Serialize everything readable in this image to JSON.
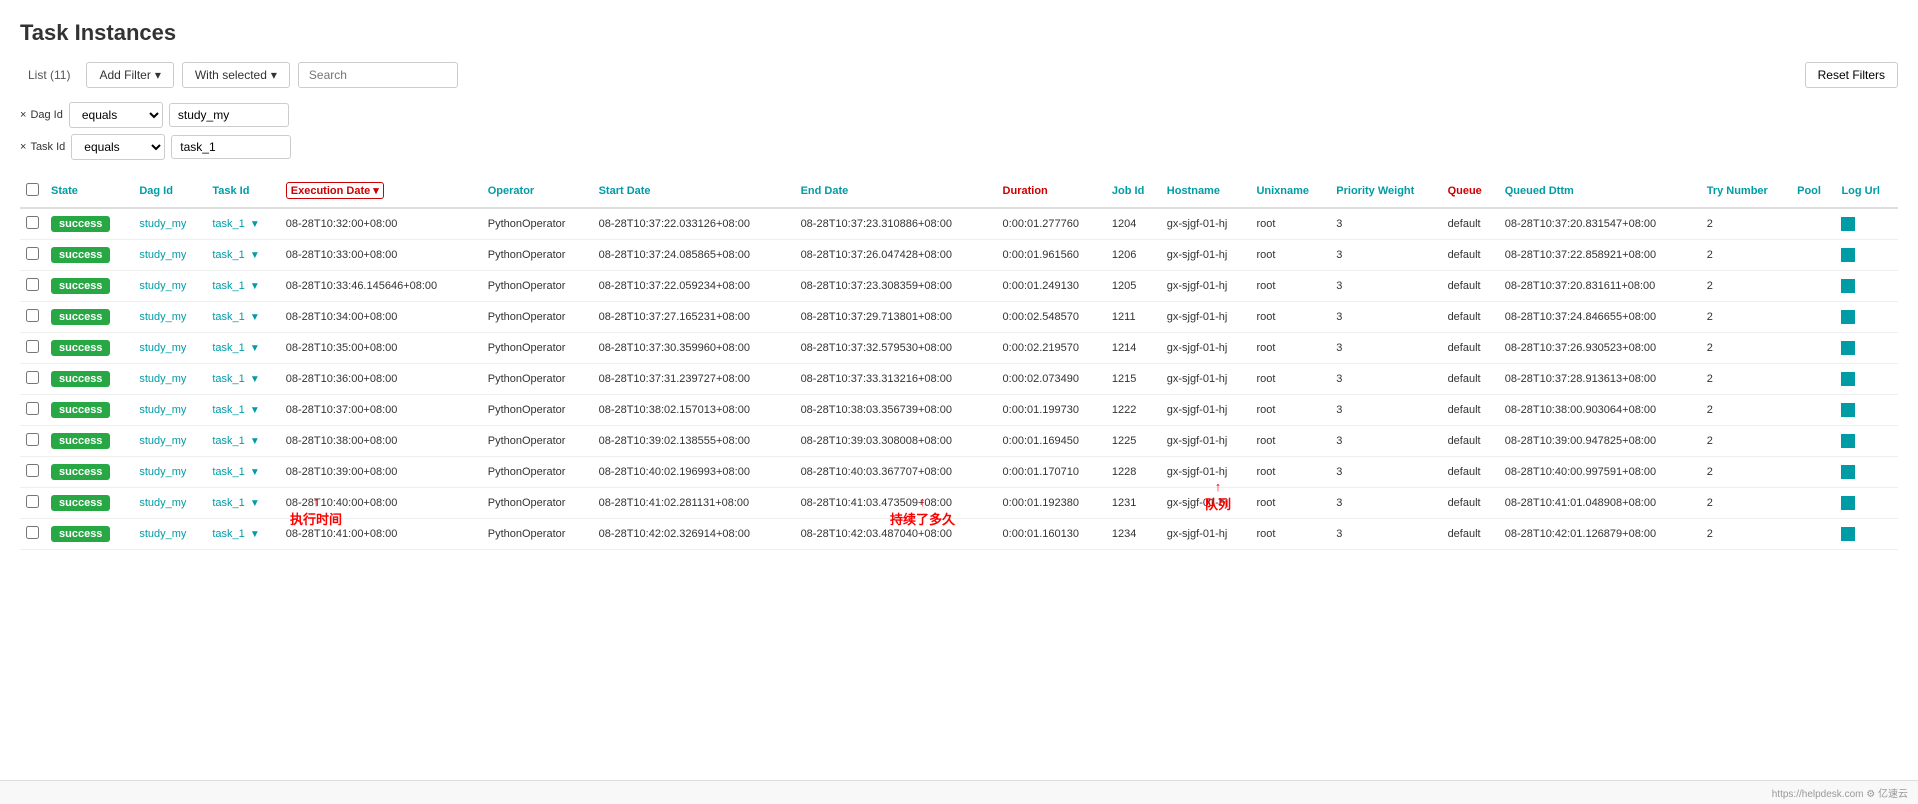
{
  "page": {
    "title": "Task Instances"
  },
  "toolbar": {
    "list_label": "List (11)",
    "add_filter_label": "Add Filter",
    "with_selected_label": "With selected",
    "search_placeholder": "Search",
    "reset_filters_label": "Reset Filters"
  },
  "filters": [
    {
      "id": "dag_id",
      "label": "Dag Id",
      "operator": "equals",
      "value": "study_my"
    },
    {
      "id": "task_id",
      "label": "Task Id",
      "operator": "equals",
      "value": "task_1"
    }
  ],
  "annotations": {
    "execution_date": "执行时间",
    "duration": "持续了多久",
    "queue": "队列"
  },
  "table": {
    "columns": [
      {
        "key": "state",
        "label": "State",
        "sortable": false
      },
      {
        "key": "dag_id",
        "label": "Dag Id",
        "sortable": false
      },
      {
        "key": "task_id",
        "label": "Task Id",
        "sortable": false
      },
      {
        "key": "execution_date",
        "label": "Execution Date",
        "sortable": true,
        "active": true,
        "highlighted": true
      },
      {
        "key": "operator",
        "label": "Operator",
        "sortable": false
      },
      {
        "key": "start_date",
        "label": "Start Date",
        "sortable": false
      },
      {
        "key": "end_date",
        "label": "End Date",
        "sortable": false
      },
      {
        "key": "duration",
        "label": "Duration",
        "sortable": false,
        "highlighted": true
      },
      {
        "key": "job_id",
        "label": "Job Id",
        "sortable": false
      },
      {
        "key": "hostname",
        "label": "Hostname",
        "sortable": false
      },
      {
        "key": "unixname",
        "label": "Unixname",
        "sortable": false
      },
      {
        "key": "priority_weight",
        "label": "Priority Weight",
        "sortable": false
      },
      {
        "key": "queue",
        "label": "Queue",
        "sortable": false,
        "highlighted": true
      },
      {
        "key": "queued_dttm",
        "label": "Queued Dttm",
        "sortable": false
      },
      {
        "key": "try_number",
        "label": "Try Number",
        "sortable": false
      },
      {
        "key": "pool",
        "label": "Pool",
        "sortable": false
      },
      {
        "key": "log_url",
        "label": "Log Url",
        "sortable": false
      }
    ],
    "rows": [
      {
        "state": "success",
        "dag_id": "study_my",
        "task_id": "task_1",
        "execution_date": "08-28T10:32:00+08:00",
        "operator": "PythonOperator",
        "start_date": "08-28T10:37:22.033126+08:00",
        "end_date": "08-28T10:37:23.310886+08:00",
        "duration": "0:00:01.277760",
        "job_id": "1204",
        "hostname": "gx-sjgf-01-hj",
        "unixname": "root",
        "priority_weight": "3",
        "queue": "default",
        "queued_dttm": "08-28T10:37:20.831547+08:00",
        "try_number": "2",
        "pool": "",
        "log_url": "box"
      },
      {
        "state": "success",
        "dag_id": "study_my",
        "task_id": "task_1",
        "execution_date": "08-28T10:33:00+08:00",
        "operator": "PythonOperator",
        "start_date": "08-28T10:37:24.085865+08:00",
        "end_date": "08-28T10:37:26.047428+08:00",
        "duration": "0:00:01.961560",
        "job_id": "1206",
        "hostname": "gx-sjgf-01-hj",
        "unixname": "root",
        "priority_weight": "3",
        "queue": "default",
        "queued_dttm": "08-28T10:37:22.858921+08:00",
        "try_number": "2",
        "pool": "",
        "log_url": "box"
      },
      {
        "state": "success",
        "dag_id": "study_my",
        "task_id": "task_1",
        "execution_date": "08-28T10:33:46.145646+08:00",
        "operator": "PythonOperator",
        "start_date": "08-28T10:37:22.059234+08:00",
        "end_date": "08-28T10:37:23.308359+08:00",
        "duration": "0:00:01.249130",
        "job_id": "1205",
        "hostname": "gx-sjgf-01-hj",
        "unixname": "root",
        "priority_weight": "3",
        "queue": "default",
        "queued_dttm": "08-28T10:37:20.831611+08:00",
        "try_number": "2",
        "pool": "",
        "log_url": "box"
      },
      {
        "state": "success",
        "dag_id": "study_my",
        "task_id": "task_1",
        "execution_date": "08-28T10:34:00+08:00",
        "operator": "PythonOperator",
        "start_date": "08-28T10:37:27.165231+08:00",
        "end_date": "08-28T10:37:29.713801+08:00",
        "duration": "0:00:02.548570",
        "job_id": "1211",
        "hostname": "gx-sjgf-01-hj",
        "unixname": "root",
        "priority_weight": "3",
        "queue": "default",
        "queued_dttm": "08-28T10:37:24.846655+08:00",
        "try_number": "2",
        "pool": "",
        "log_url": "box"
      },
      {
        "state": "success",
        "dag_id": "study_my",
        "task_id": "task_1",
        "execution_date": "08-28T10:35:00+08:00",
        "operator": "PythonOperator",
        "start_date": "08-28T10:37:30.359960+08:00",
        "end_date": "08-28T10:37:32.579530+08:00",
        "duration": "0:00:02.219570",
        "job_id": "1214",
        "hostname": "gx-sjgf-01-hj",
        "unixname": "root",
        "priority_weight": "3",
        "queue": "default",
        "queued_dttm": "08-28T10:37:26.930523+08:00",
        "try_number": "2",
        "pool": "",
        "log_url": "box"
      },
      {
        "state": "success",
        "dag_id": "study_my",
        "task_id": "task_1",
        "execution_date": "08-28T10:36:00+08:00",
        "operator": "PythonOperator",
        "start_date": "08-28T10:37:31.239727+08:00",
        "end_date": "08-28T10:37:33.313216+08:00",
        "duration": "0:00:02.073490",
        "job_id": "1215",
        "hostname": "gx-sjgf-01-hj",
        "unixname": "root",
        "priority_weight": "3",
        "queue": "default",
        "queued_dttm": "08-28T10:37:28.913613+08:00",
        "try_number": "2",
        "pool": "",
        "log_url": "box"
      },
      {
        "state": "success",
        "dag_id": "study_my",
        "task_id": "task_1",
        "execution_date": "08-28T10:37:00+08:00",
        "operator": "PythonOperator",
        "start_date": "08-28T10:38:02.157013+08:00",
        "end_date": "08-28T10:38:03.356739+08:00",
        "duration": "0:00:01.199730",
        "job_id": "1222",
        "hostname": "gx-sjgf-01-hj",
        "unixname": "root",
        "priority_weight": "3",
        "queue": "default",
        "queued_dttm": "08-28T10:38:00.903064+08:00",
        "try_number": "2",
        "pool": "",
        "log_url": "box"
      },
      {
        "state": "success",
        "dag_id": "study_my",
        "task_id": "task_1",
        "execution_date": "08-28T10:38:00+08:00",
        "operator": "PythonOperator",
        "start_date": "08-28T10:39:02.138555+08:00",
        "end_date": "08-28T10:39:03.308008+08:00",
        "duration": "0:00:01.169450",
        "job_id": "1225",
        "hostname": "gx-sjgf-01-hj",
        "unixname": "root",
        "priority_weight": "3",
        "queue": "default",
        "queued_dttm": "08-28T10:39:00.947825+08:00",
        "try_number": "2",
        "pool": "",
        "log_url": "box"
      },
      {
        "state": "success",
        "dag_id": "study_my",
        "task_id": "task_1",
        "execution_date": "08-28T10:39:00+08:00",
        "operator": "PythonOperator",
        "start_date": "08-28T10:40:02.196993+08:00",
        "end_date": "08-28T10:40:03.367707+08:00",
        "duration": "0:00:01.170710",
        "job_id": "1228",
        "hostname": "gx-sjgf-01-hj",
        "unixname": "root",
        "priority_weight": "3",
        "queue": "default",
        "queued_dttm": "08-28T10:40:00.997591+08:00",
        "try_number": "2",
        "pool": "",
        "log_url": "box"
      },
      {
        "state": "success",
        "dag_id": "study_my",
        "task_id": "task_1",
        "execution_date": "08-28T10:40:00+08:00",
        "operator": "PythonOperator",
        "start_date": "08-28T10:41:02.281131+08:00",
        "end_date": "08-28T10:41:03.473509+08:00",
        "duration": "0:00:01.192380",
        "job_id": "1231",
        "hostname": "gx-sjgf-01-hj",
        "unixname": "root",
        "priority_weight": "3",
        "queue": "default",
        "queued_dttm": "08-28T10:41:01.048908+08:00",
        "try_number": "2",
        "pool": "",
        "log_url": "box"
      },
      {
        "state": "success",
        "dag_id": "study_my",
        "task_id": "task_1",
        "execution_date": "08-28T10:41:00+08:00",
        "operator": "PythonOperator",
        "start_date": "08-28T10:42:02.326914+08:00",
        "end_date": "08-28T10:42:03.487040+08:00",
        "duration": "0:00:01.160130",
        "job_id": "1234",
        "hostname": "gx-sjgf-01-hj",
        "unixname": "root",
        "priority_weight": "3",
        "queue": "default",
        "queued_dttm": "08-28T10:42:01.126879+08:00",
        "try_number": "2",
        "pool": "",
        "log_url": "box"
      }
    ]
  },
  "footer": {
    "left": "",
    "right": "https://helpdesk.com    ⚙ 亿速云"
  }
}
